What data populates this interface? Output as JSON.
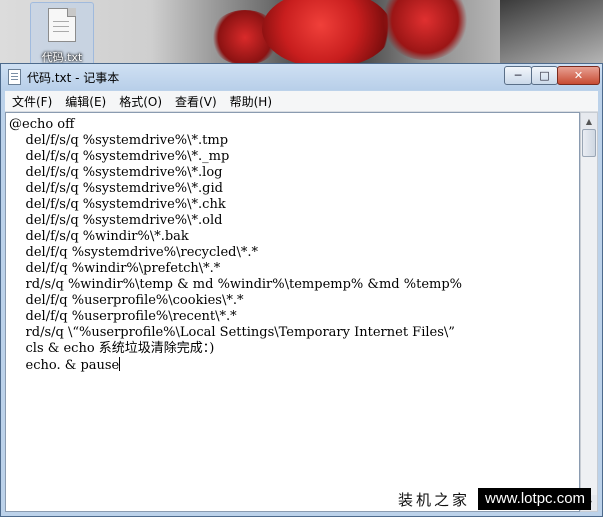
{
  "desktop": {
    "icon_label": "代码.txt"
  },
  "window": {
    "title": "代码.txt - 记事本",
    "controls": {
      "minimize": "─",
      "maximize": "□",
      "close": "✕"
    }
  },
  "menubar": {
    "items": [
      {
        "label": "文件(F)"
      },
      {
        "label": "编辑(E)"
      },
      {
        "label": "格式(O)"
      },
      {
        "label": "查看(V)"
      },
      {
        "label": "帮助(H)"
      }
    ]
  },
  "editor": {
    "text": "@echo off\n    del/f/s/q %systemdrive%\\*.tmp\n    del/f/s/q %systemdrive%\\*._mp\n    del/f/s/q %systemdrive%\\*.log\n    del/f/s/q %systemdrive%\\*.gid\n    del/f/s/q %systemdrive%\\*.chk\n    del/f/s/q %systemdrive%\\*.old\n    del/f/s/q %windir%\\*.bak\n    del/f/q %systemdrive%\\recycled\\*.*\n    del/f/q %windir%\\prefetch\\*.*\n    rd/s/q %windir%\\temp & md %windir%\\tempemp% &md %temp%\n    del/f/q %userprofile%\\cookies\\*.*\n    del/f/q %userprofile%\\recent\\*.*\n    rd/s/q \\“%userprofile%\\Local Settings\\Temporary Internet Files\\”\n    cls & echo 系统垃圾清除完成：)\n    echo. & pause"
  },
  "watermark": {
    "site_name": "装机之家",
    "url": "www.lotpc.com"
  }
}
